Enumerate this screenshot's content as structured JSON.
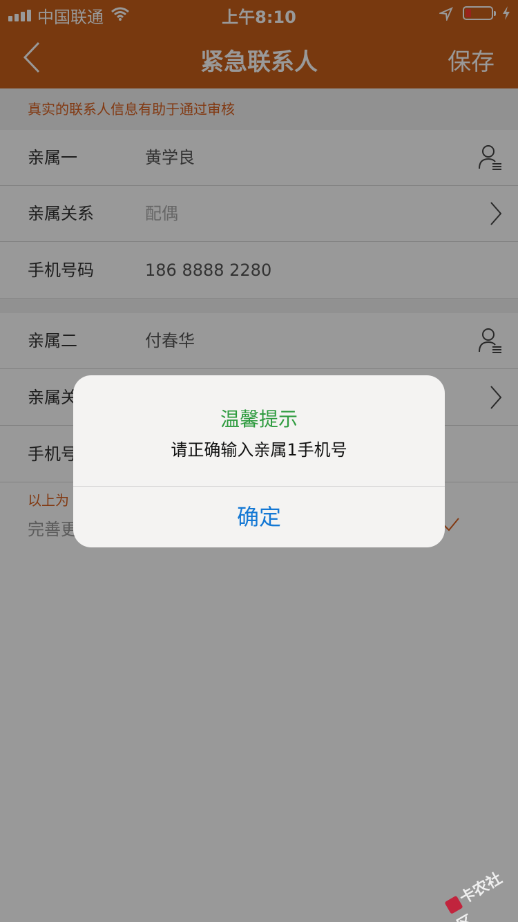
{
  "status_bar": {
    "carrier": "中国联通",
    "time": "上午8:10"
  },
  "nav": {
    "title": "紧急联系人",
    "save": "保存"
  },
  "hint": "真实的联系人信息有助于通过审核",
  "contact1": {
    "name_label": "亲属一",
    "name_value": "黄学良",
    "relation_label": "亲属关系",
    "relation_value": "配偶",
    "phone_label": "手机号码",
    "phone_value": "186 8888 2280"
  },
  "contact2": {
    "name_label": "亲属二",
    "name_value": "付春华",
    "relation_label": "亲属关",
    "phone_label": "手机号"
  },
  "footer": {
    "note": "以上为",
    "link": "完善更"
  },
  "alert": {
    "title": "温馨提示",
    "message": "请正确输入亲属1手机号",
    "confirm": "确定"
  },
  "watermark": "卡农社区",
  "colors": {
    "brand": "#c95f19",
    "hint_text": "#d9601e",
    "alert_title": "#2e9b3f",
    "alert_button": "#1478d4"
  }
}
